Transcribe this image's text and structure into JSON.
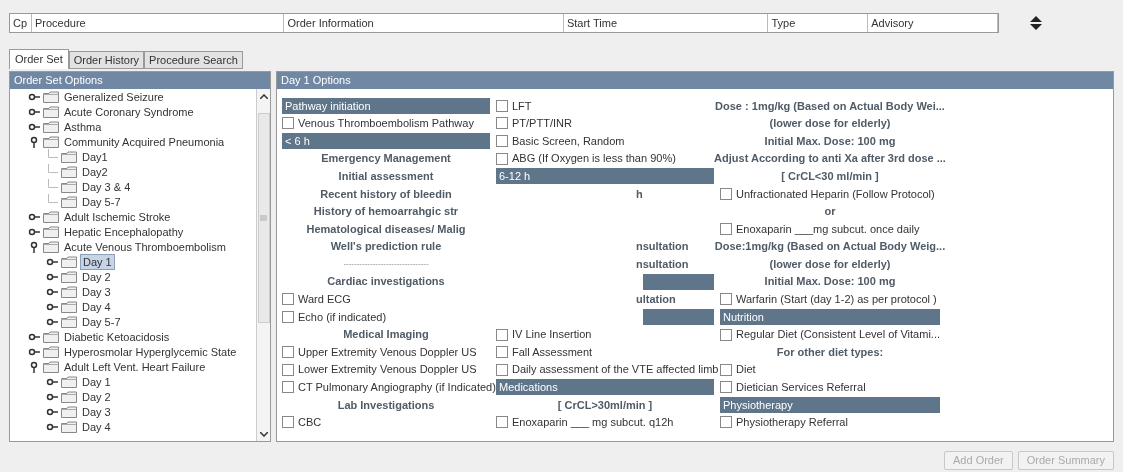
{
  "order_table": {
    "columns": [
      "Cp",
      "Procedure",
      "Order Information",
      "Start Time",
      "Type",
      "Advisory"
    ]
  },
  "tabs": [
    {
      "label": "Order Set",
      "selected": true
    },
    {
      "label": "Order History",
      "selected": false
    },
    {
      "label": "Procedure Search",
      "selected": false
    }
  ],
  "order_set_options": {
    "title": "Order Set Options",
    "tree": [
      {
        "label": "Generalized Seizure",
        "kind": "branch",
        "expanded": false,
        "selected": false
      },
      {
        "label": "Acute Coronary Syndrome",
        "kind": "branch",
        "expanded": false,
        "selected": false
      },
      {
        "label": "Asthma",
        "kind": "branch",
        "expanded": false,
        "selected": false
      },
      {
        "label": "Community Acquired Pneumonia",
        "kind": "branch",
        "expanded": true,
        "selected": false,
        "children": [
          {
            "label": "Day1",
            "kind": "leaf",
            "selected": false
          },
          {
            "label": "Day2",
            "kind": "leaf",
            "selected": false
          },
          {
            "label": "Day 3 & 4",
            "kind": "leaf",
            "selected": false
          },
          {
            "label": "Day 5-7",
            "kind": "leaf",
            "selected": false
          }
        ]
      },
      {
        "label": "Adult Ischemic Stroke",
        "kind": "branch",
        "expanded": false,
        "selected": false
      },
      {
        "label": "Hepatic Encephalopathy",
        "kind": "branch",
        "expanded": false,
        "selected": false
      },
      {
        "label": "Acute Venous Thromboembolism",
        "kind": "branch",
        "expanded": true,
        "selected": false,
        "children": [
          {
            "label": "Day 1",
            "kind": "branch",
            "expanded": false,
            "selected": true
          },
          {
            "label": "Day 2",
            "kind": "branch",
            "expanded": false,
            "selected": false
          },
          {
            "label": "Day 3",
            "kind": "branch",
            "expanded": false,
            "selected": false
          },
          {
            "label": "Day 4",
            "kind": "branch",
            "expanded": false,
            "selected": false
          },
          {
            "label": "Day 5-7",
            "kind": "branch",
            "expanded": false,
            "selected": false
          }
        ]
      },
      {
        "label": "Diabetic Ketoacidosis",
        "kind": "branch",
        "expanded": false,
        "selected": false
      },
      {
        "label": "Hyperosmolar Hyperglycemic State",
        "kind": "branch",
        "expanded": false,
        "selected": false
      },
      {
        "label": "Adult Left Vent. Heart Failure",
        "kind": "branch",
        "expanded": true,
        "selected": false,
        "children": [
          {
            "label": "Day 1",
            "kind": "branch",
            "expanded": false,
            "selected": false
          },
          {
            "label": "Day 2",
            "kind": "branch",
            "expanded": false,
            "selected": false
          },
          {
            "label": "Day 3",
            "kind": "branch",
            "expanded": false,
            "selected": false
          },
          {
            "label": "Day 4",
            "kind": "branch",
            "expanded": false,
            "selected": false
          }
        ]
      }
    ]
  },
  "day_options": {
    "title": "Day 1 Options",
    "columns": [
      [
        {
          "kind": "header",
          "text": "Pathway initiation"
        },
        {
          "kind": "check",
          "text": "Venous Thromboembolism Pathway",
          "checked": false
        },
        {
          "kind": "header",
          "text": "< 6 h"
        },
        {
          "kind": "bold",
          "text": "Emergency Management"
        },
        {
          "kind": "bold",
          "text": "Initial assessment"
        },
        {
          "kind": "bold",
          "text": "Recent history of bleedin"
        },
        {
          "kind": "bold",
          "text": "History of hemoarrahgic str"
        },
        {
          "kind": "bold",
          "text": "Hematological diseases/ Malig"
        },
        {
          "kind": "bold",
          "text": "Well's prediction rule"
        },
        {
          "kind": "separator",
          "text": "--------------------------------"
        },
        {
          "kind": "bold",
          "text": "Cardiac investigations"
        },
        {
          "kind": "check",
          "text": "Ward ECG",
          "checked": false
        },
        {
          "kind": "check",
          "text": "Echo (if indicated)",
          "checked": false
        },
        {
          "kind": "bold",
          "text": "Medical Imaging"
        },
        {
          "kind": "check",
          "text": "Upper Extremity Venous Doppler US",
          "checked": false
        },
        {
          "kind": "check",
          "text": "Lower Extremity Venous Doppler US",
          "checked": false
        },
        {
          "kind": "check",
          "text": "CT Pulmonary Angiography (if Indicated)",
          "checked": false
        },
        {
          "kind": "bold",
          "text": "Lab Investigations"
        },
        {
          "kind": "check",
          "text": "CBC",
          "checked": false
        }
      ],
      [
        {
          "kind": "check",
          "text": "LFT",
          "checked": false
        },
        {
          "kind": "check",
          "text": "PT/PTT/INR",
          "checked": false
        },
        {
          "kind": "check",
          "text": "Basic Screen, Random",
          "checked": false
        },
        {
          "kind": "check",
          "text": "ABG (If Oxygen is less than 90%)",
          "checked": false
        },
        {
          "kind": "header",
          "text": "6-12 h"
        },
        {
          "kind": "fragment",
          "text": "h"
        },
        {
          "kind": "blank"
        },
        {
          "kind": "blank"
        },
        {
          "kind": "fragment",
          "text": "nsultation"
        },
        {
          "kind": "fragment",
          "text": "nsultation"
        },
        {
          "kind": "bar"
        },
        {
          "kind": "fragment",
          "text": "ultation"
        },
        {
          "kind": "bar"
        },
        {
          "kind": "check",
          "text": "IV Line Insertion",
          "checked": false
        },
        {
          "kind": "check",
          "text": "Fall Assessment",
          "checked": false
        },
        {
          "kind": "check",
          "text": "Daily assessment of the VTE affected limb",
          "checked": false
        },
        {
          "kind": "header",
          "text": "Medications"
        },
        {
          "kind": "bold",
          "text": "[ CrCL>30ml/min ]"
        },
        {
          "kind": "check",
          "text": "Enoxaparin ___ mg subcut. q12h",
          "checked": false
        }
      ],
      [
        {
          "kind": "bold",
          "text": "Dose : 1mg/kg (Based on Actual Body Wei..."
        },
        {
          "kind": "bold",
          "text": "(lower dose for elderly)"
        },
        {
          "kind": "bold",
          "text": "Initial Max. Dose: 100 mg"
        },
        {
          "kind": "bold",
          "text": "Adjust According to anti Xa after 3rd dose ..."
        },
        {
          "kind": "bold",
          "text": "[ CrCL<30 ml/min ]"
        },
        {
          "kind": "check",
          "text": "Unfractionated Heparin (Follow Protocol)",
          "checked": false
        },
        {
          "kind": "bold",
          "text": "or"
        },
        {
          "kind": "check",
          "text": "Enoxaparin ___mg subcut. once daily",
          "checked": false
        },
        {
          "kind": "bold",
          "text": "Dose:1mg/kg (Based on Actual Body Weig..."
        },
        {
          "kind": "bold",
          "text": "(lower dose for elderly)"
        },
        {
          "kind": "bold",
          "text": "Initial Max. Dose: 100 mg"
        },
        {
          "kind": "check",
          "text": "Warfarin (Start (day 1-2) as per protocol )",
          "checked": false
        },
        {
          "kind": "header",
          "text": "Nutrition"
        },
        {
          "kind": "check",
          "text": "Regular Diet (Consistent Level of Vitami...",
          "checked": false
        },
        {
          "kind": "bold",
          "text": "For other diet types:"
        },
        {
          "kind": "check",
          "text": "Diet",
          "checked": false
        },
        {
          "kind": "check",
          "text": "Dietician Services Referral",
          "checked": false
        },
        {
          "kind": "header",
          "text": "Physiotherapy"
        },
        {
          "kind": "check",
          "text": "Physiotherapy Referral",
          "checked": false
        }
      ]
    ]
  },
  "buttons": [
    {
      "label": "Add Order",
      "disabled": true
    },
    {
      "label": "Order Summary",
      "disabled": true
    }
  ]
}
